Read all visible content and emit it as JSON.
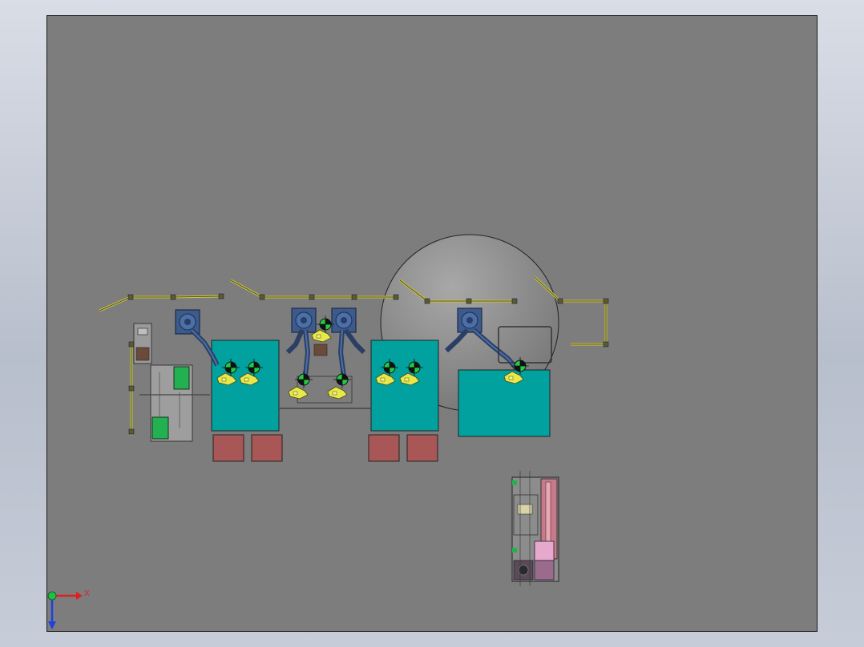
{
  "window": {
    "title": ""
  },
  "viewport": {
    "background": "#7d7d7d"
  },
  "colors": {
    "table": "#00a19e",
    "pallet": "#a85656",
    "fence": "#c8c23c",
    "robot_base": "#3d5a8a",
    "dome": "#8a8a8a",
    "highlight_green": "#26b34a",
    "yellow_part": "#e8e84a"
  },
  "triad": {
    "x_label": "X"
  },
  "icons": [
    "coordinate-triad-icon",
    "origin-sphere-icon"
  ]
}
